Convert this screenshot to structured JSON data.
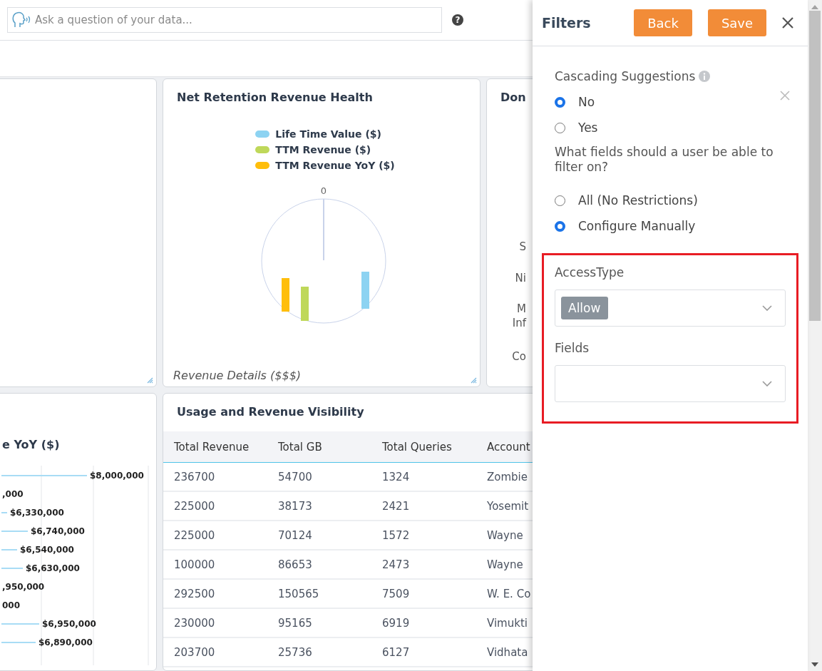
{
  "search": {
    "placeholder": "Ask a question of your data..."
  },
  "help_icon": "?",
  "revenue_yoy_card": {
    "title": "e YoY ($)",
    "value_labels": [
      "$8,000,000",
      ",000",
      "$6,330,000",
      "$6,740,000",
      "$6,540,000",
      "$6,630,000",
      ",950,000",
      "000",
      "$6,950,000",
      "$6,890,000"
    ]
  },
  "net_retention_card": {
    "title": "Net Retention Revenue Health",
    "legend": [
      {
        "label": "Life Time Value ($)",
        "color": "#8dd3f2"
      },
      {
        "label": "TTM Revenue ($)",
        "color": "#bfd85a"
      },
      {
        "label": "TTM Revenue YoY ($)",
        "color": "#ffbe0b"
      }
    ],
    "axis_label": "0",
    "caption": "Revenue Details ($$$)"
  },
  "third_card": {
    "title": "Don",
    "row_labels": [
      "S",
      "Ni",
      "M",
      "Inf",
      "Co"
    ]
  },
  "usage_card": {
    "title": "Usage and Revenue Visibility",
    "table": {
      "columns": [
        "Total Revenue",
        "Total GB",
        "Total Queries",
        "Account"
      ],
      "rows": [
        [
          "236700",
          "54700",
          "1324",
          "Zombie"
        ],
        [
          "225000",
          "38173",
          "2421",
          "Yosemit"
        ],
        [
          "225000",
          "70124",
          "1572",
          "Wayne"
        ],
        [
          "100000",
          "86653",
          "2473",
          "Wayne"
        ],
        [
          "292500",
          "150565",
          "7509",
          "W. E. Co"
        ],
        [
          "230000",
          "95165",
          "6919",
          "Vimukti"
        ],
        [
          "203700",
          "25736",
          "6127",
          "Vidhata"
        ]
      ]
    }
  },
  "filters_panel": {
    "title": "Filters",
    "buttons": [
      "Back",
      "Save"
    ],
    "cascading": {
      "label": "Cascading Suggestions",
      "options": [
        {
          "label": "No",
          "selected": true
        },
        {
          "label": "Yes",
          "selected": false
        }
      ]
    },
    "question": "What fields should a user be able to filter on?",
    "field_options": [
      {
        "label": "All (No Restrictions)",
        "selected": false
      },
      {
        "label": "Configure Manually",
        "selected": true
      }
    ],
    "access_type": {
      "label": "AccessType",
      "chips": [
        "Allow"
      ]
    },
    "fields": {
      "label": "Fields"
    }
  }
}
